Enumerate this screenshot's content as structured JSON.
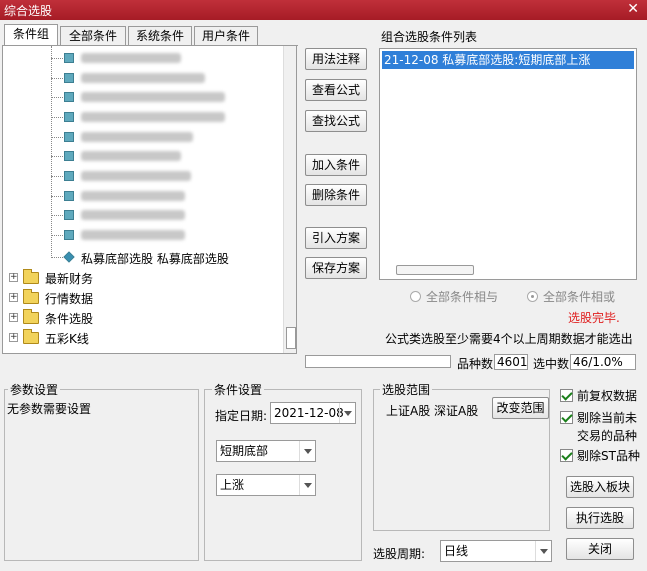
{
  "window": {
    "title": "综合选股",
    "close_glyph": "✕"
  },
  "tabs": [
    "条件组",
    "全部条件",
    "系统条件",
    "用户条件"
  ],
  "tree": {
    "selected_leaf": "私募底部选股 私募底部选股",
    "folders": [
      "最新财务",
      "行情数据",
      "条件选股",
      "五彩K线"
    ],
    "expander_glyph": "+"
  },
  "buttons": {
    "usage_note": "用法注释",
    "view_formula": "查看公式",
    "find_formula": "查找公式",
    "add_condition": "加入条件",
    "delete_condition": "删除条件",
    "import_plan": "引入方案",
    "save_plan": "保存方案",
    "change_range": "改变范围",
    "select_to_block": "选股入板块",
    "execute": "执行选股",
    "close": "关闭"
  },
  "condition_list": {
    "label": "组合选股条件列表",
    "items": [
      "21-12-08 私募底部选股:短期底部上涨"
    ]
  },
  "logic": {
    "and_label": "全部条件相与",
    "or_label": "全部条件相或",
    "selected": "or"
  },
  "status": {
    "done": "选股完毕.",
    "note": "公式类选股至少需要4个以上周期数据才能选出",
    "count_label": "品种数",
    "count_value": "4601",
    "selected_label": "选中数",
    "selected_value": "46/1.0%"
  },
  "params": {
    "title": "参数设置",
    "text": "无参数需要设置"
  },
  "cond_settings": {
    "title": "条件设置",
    "date_label": "指定日期:",
    "date_value": "2021-12-08",
    "combo1": "短期底部",
    "combo2": "上涨"
  },
  "range": {
    "title": "选股范围",
    "text": "上证A股 深证A股"
  },
  "options": {
    "adjusted": "前复权数据",
    "exclude_untraded_1": "剔除当前未",
    "exclude_untraded_2": "交易的品种",
    "exclude_st": "剔除ST品种"
  },
  "period": {
    "label": "选股周期:",
    "value": "日线"
  },
  "colors": {
    "title_bar": "#b3242e",
    "selection": "#2f7fd8",
    "done_text": "#e02020"
  }
}
